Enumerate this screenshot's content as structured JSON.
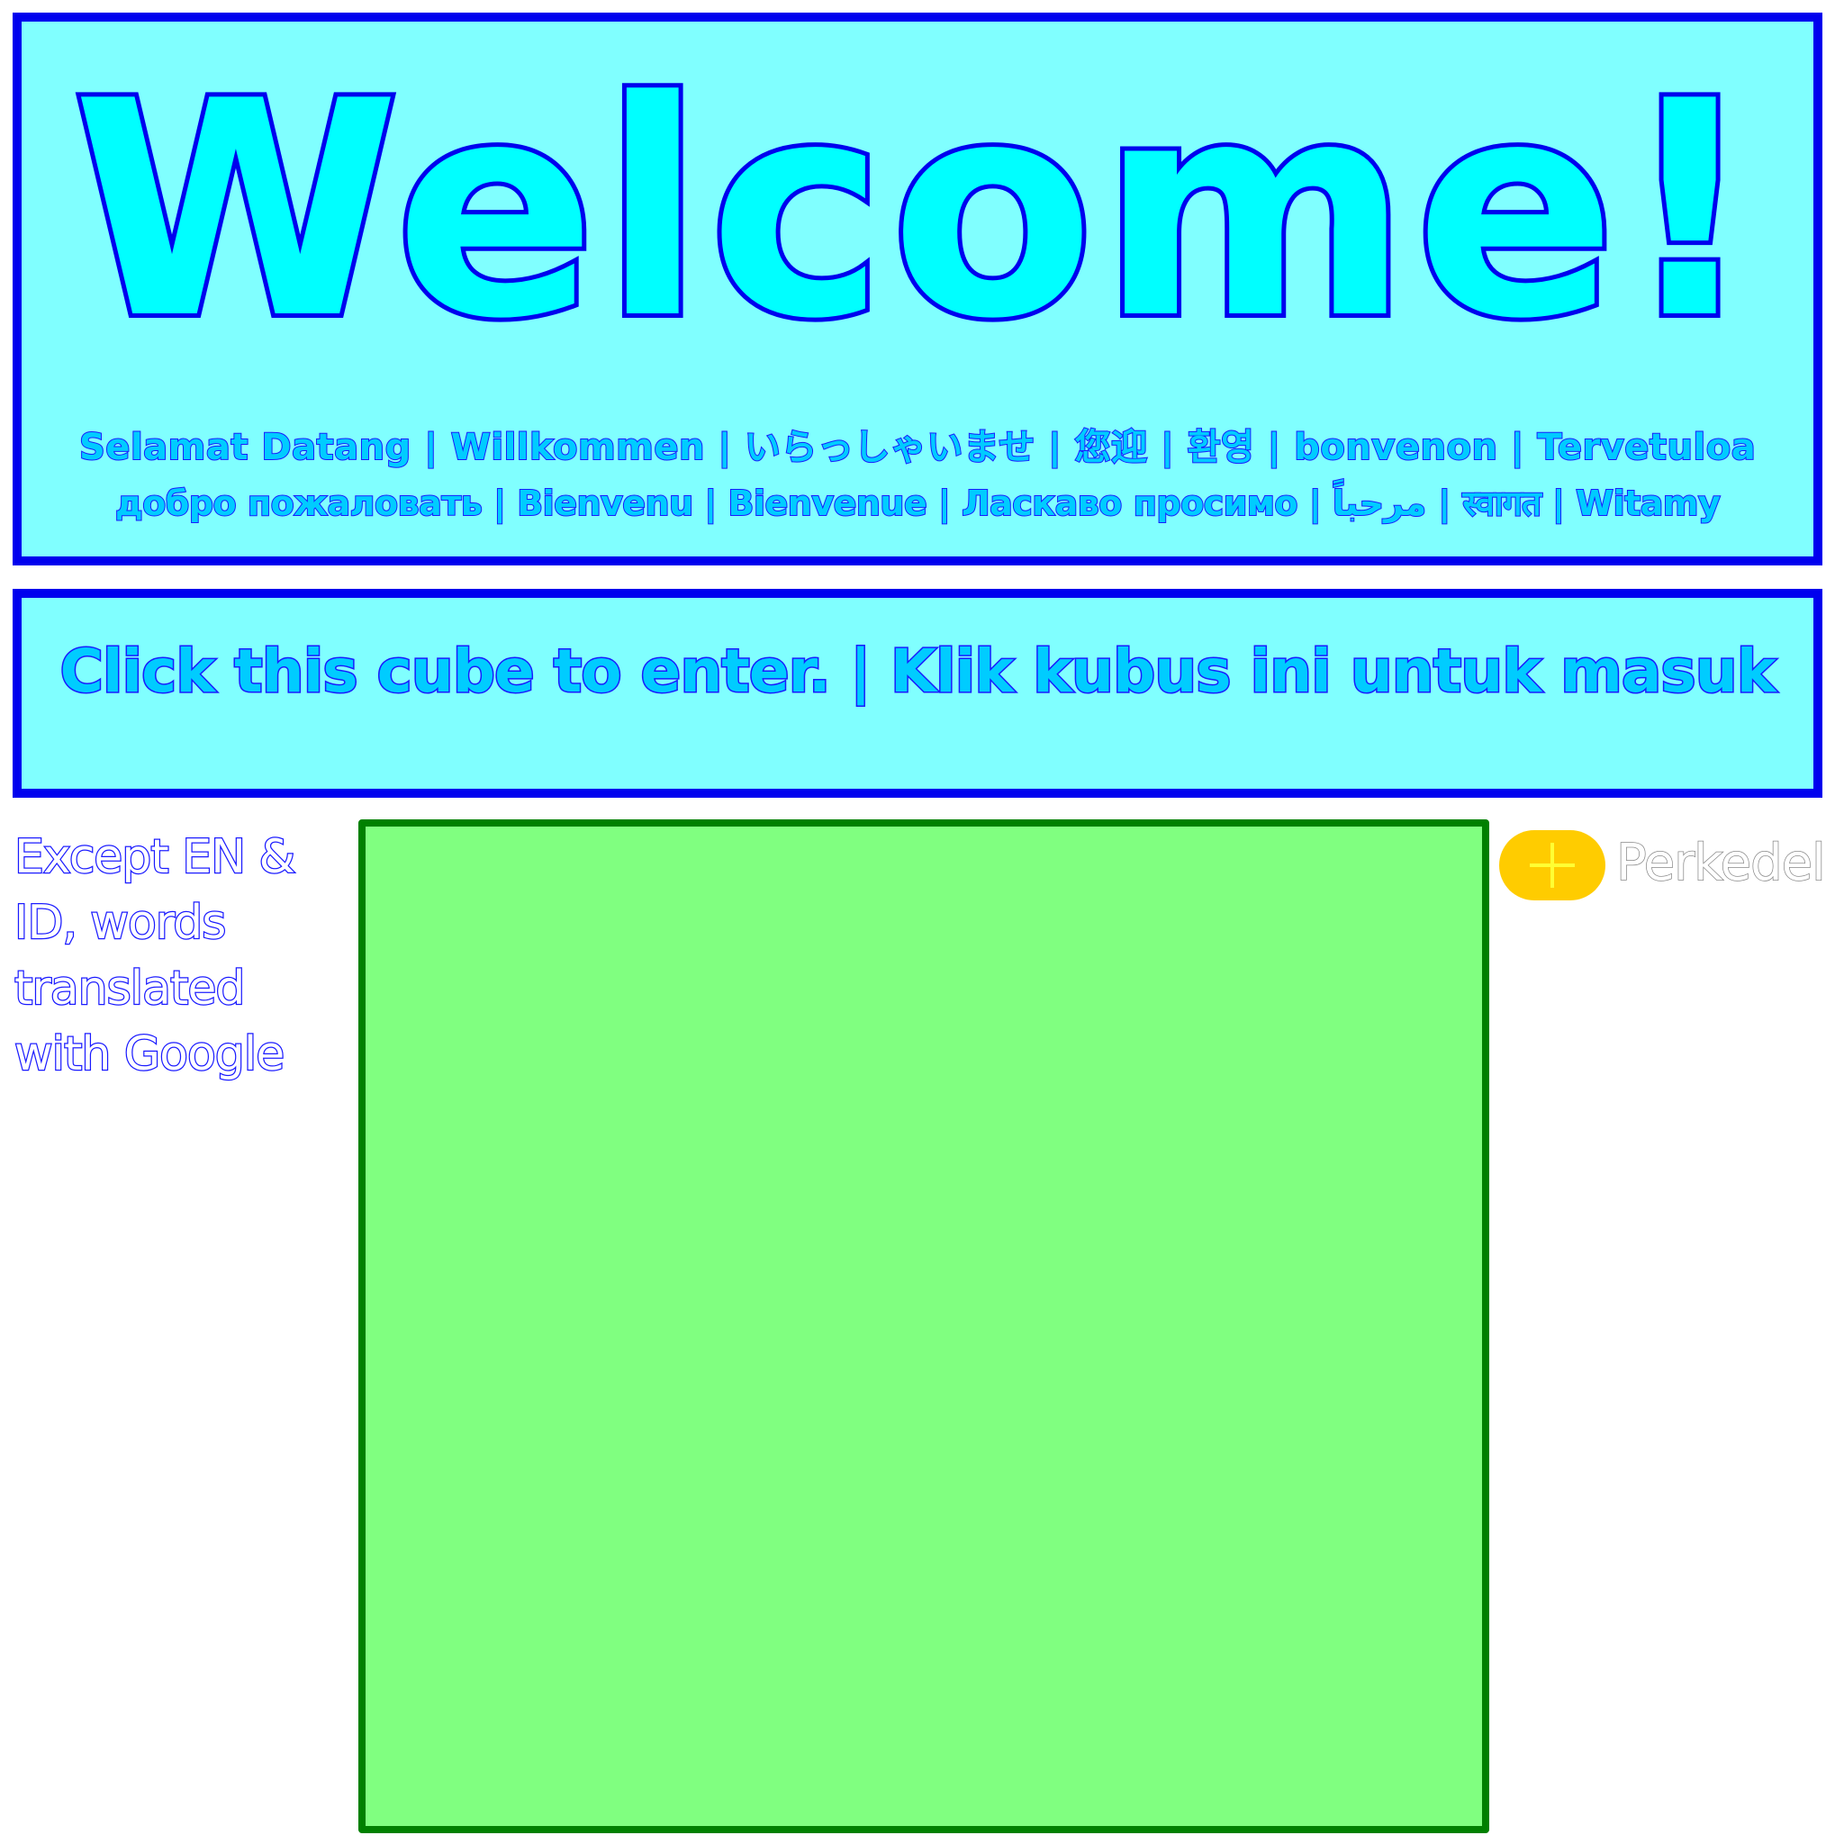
{
  "welcome": {
    "title": "Welcome!",
    "languages_line1": "Selamat Datang | Willkommen | いらっしゃいませ | 您迎 | 환영 | bonvenon | Tervetuloa",
    "languages_line2": "добро пожаловать | Bienvenu | Bienvenue | Ласкаво просимо | مرحباً | स्वागत | Witamy"
  },
  "enter": {
    "instruction": "Click this cube to enter. | Klik kubus ini untuk masuk"
  },
  "note": {
    "text": "Except EN & ID, words translated with Google"
  },
  "add_button": {
    "icon": "plus-icon",
    "label": "Perkedel"
  },
  "colors": {
    "panel_fill": "#80ffff",
    "panel_border": "#0000ee",
    "title_fill": "#00ffff",
    "cube_fill": "#80ff80",
    "cube_border": "#008000",
    "pill_fill": "#ffcc00",
    "plus_color": "#ffff33"
  }
}
